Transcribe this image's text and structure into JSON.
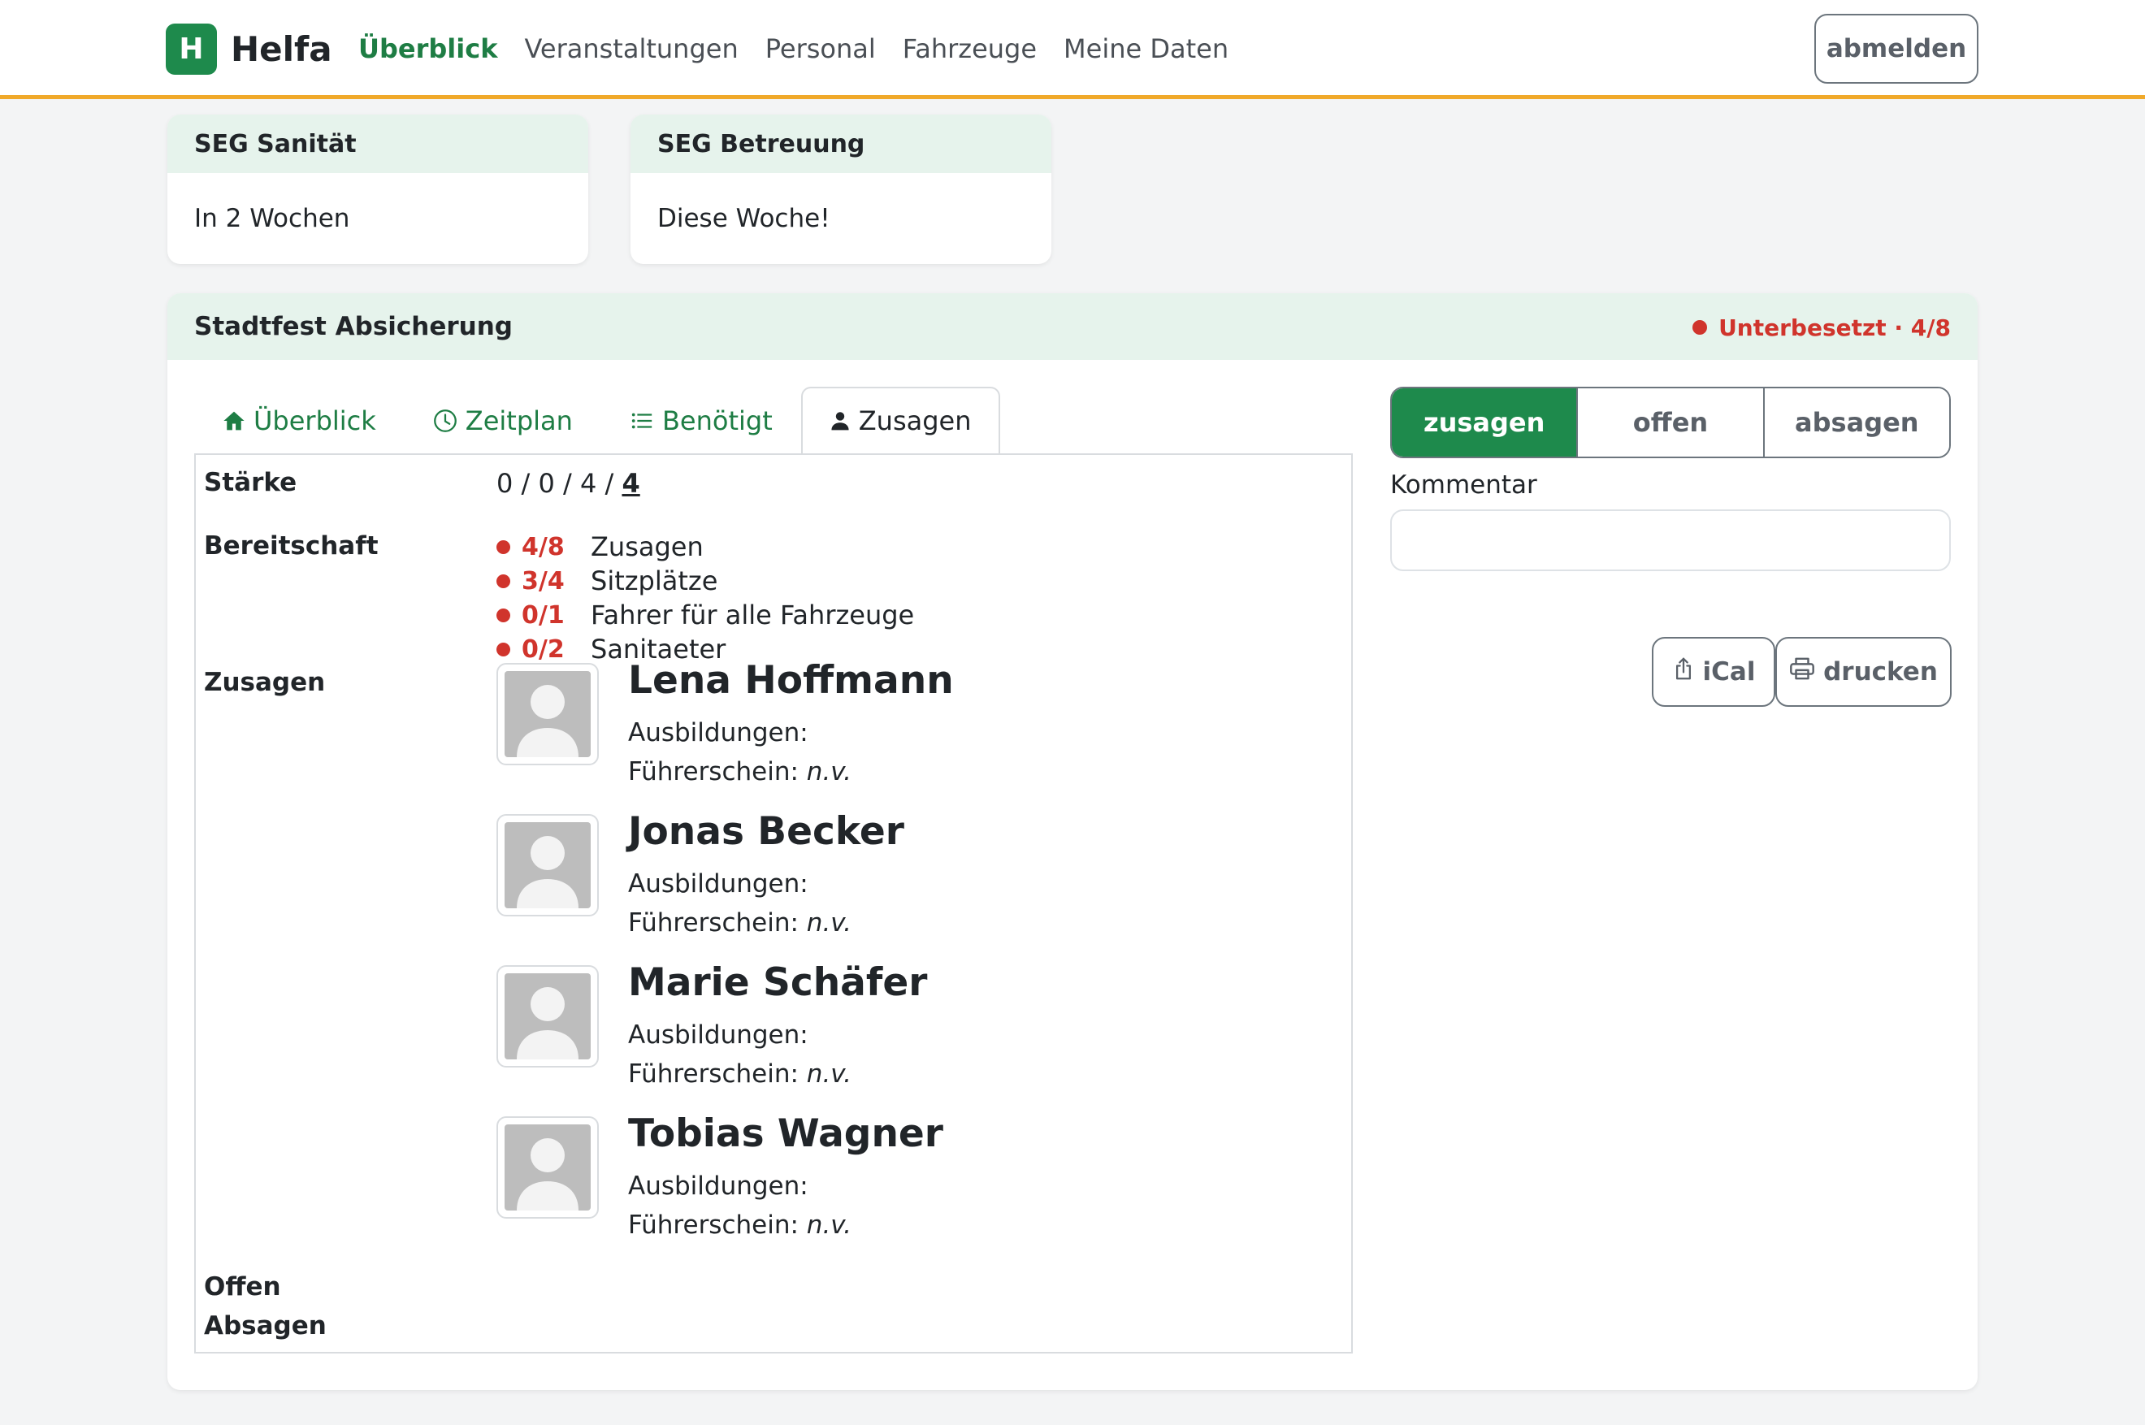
{
  "navbar": {
    "logo_letter": "H",
    "brand": "Helfa",
    "items": [
      {
        "label": "Überblick",
        "active": true
      },
      {
        "label": "Veranstaltungen",
        "active": false
      },
      {
        "label": "Personal",
        "active": false
      },
      {
        "label": "Fahrzeuge",
        "active": false
      },
      {
        "label": "Meine Daten",
        "active": false
      }
    ],
    "logout_label": "abmelden"
  },
  "groups": [
    {
      "title": "SEG Sanität",
      "subtitle": "In 2 Wochen"
    },
    {
      "title": "SEG Betreuung",
      "subtitle": "Diese Woche!"
    }
  ],
  "event": {
    "title": "Stadtfest Absicherung",
    "status": "Unterbesetzt · 4/8",
    "tabs": [
      {
        "label": "Überblick",
        "icon": "house-icon"
      },
      {
        "label": "Zeitplan",
        "icon": "clock-icon"
      },
      {
        "label": "Benötigt",
        "icon": "list-icon"
      },
      {
        "label": "Zusagen",
        "icon": "person-icon"
      }
    ],
    "active_tab": "Zusagen",
    "labels": {
      "strength": "Stärke",
      "readiness": "Bereitschaft",
      "commitments": "Zusagen",
      "open": "Offen",
      "declined": "Absagen"
    },
    "strength_prefix": "0 / 0 / 4 / ",
    "strength_total": "4",
    "readiness": [
      {
        "ratio": "4/8",
        "label": "Zusagen"
      },
      {
        "ratio": "3/4",
        "label": "Sitzplätze"
      },
      {
        "ratio": "0/1",
        "label": "Fahrer für alle Fahrzeuge"
      },
      {
        "ratio": "0/2",
        "label": "Sanitaeter"
      }
    ],
    "people": [
      {
        "name": "Lena Hoffmann",
        "training_label": "Ausbildungen:",
        "license_label": "Führerschein:",
        "license_value": "n.v."
      },
      {
        "name": "Jonas Becker",
        "training_label": "Ausbildungen:",
        "license_label": "Führerschein:",
        "license_value": "n.v."
      },
      {
        "name": "Marie Schäfer",
        "training_label": "Ausbildungen:",
        "license_label": "Führerschein:",
        "license_value": "n.v."
      },
      {
        "name": "Tobias Wagner",
        "training_label": "Ausbildungen:",
        "license_label": "Führerschein:",
        "license_value": "n.v."
      }
    ]
  },
  "response": {
    "options": [
      "zusagen",
      "offen",
      "absagen"
    ],
    "selected": "zusagen",
    "comment_label": "Kommentar",
    "comment_value": "",
    "comment_placeholder": ""
  },
  "actions": {
    "ical_label": "iCal",
    "print_label": "drucken"
  },
  "colors": {
    "primary": "#1e8a4c",
    "accent_bar": "#f0a92a",
    "danger": "#d0342c",
    "card_header": "#e6f3ec"
  }
}
